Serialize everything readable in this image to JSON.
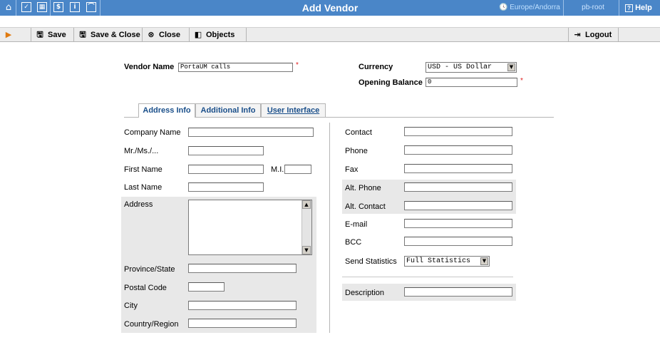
{
  "window": {
    "title": "Add Vendor",
    "timezone": "Europe/Andorra",
    "user": "pb-root",
    "help_label": "Help"
  },
  "topbar_icons": [
    "home-icon",
    "checkbox-icon",
    "calculator-icon",
    "dollar-icon",
    "info-icon",
    "chart-icon"
  ],
  "toolbar": {
    "save_label": "Save",
    "save_close_label": "Save & Close",
    "close_label": "Close",
    "objects_label": "Objects",
    "logout_label": "Logout"
  },
  "vendor": {
    "name_label": "Vendor Name",
    "name_value": "PortaUM calls",
    "currency_label": "Currency",
    "currency_value": "USD - US Dollar",
    "opening_balance_label": "Opening Balance",
    "opening_balance_value": "0"
  },
  "tabs": [
    {
      "label": "Address Info",
      "active": true
    },
    {
      "label": "Additional Info",
      "active": false
    },
    {
      "label": "User Interface",
      "active": false
    }
  ],
  "address": {
    "company_name": "Company Name",
    "salutation": "Mr./Ms./...",
    "first_name": "First Name",
    "mi": "M.I.",
    "last_name": "Last Name",
    "address": "Address",
    "province": "Province/State",
    "postal_code": "Postal Code",
    "city": "City",
    "country": "Country/Region"
  },
  "contact": {
    "contact": "Contact",
    "phone": "Phone",
    "fax": "Fax",
    "alt_phone": "Alt. Phone",
    "alt_contact": "Alt. Contact",
    "email": "E-mail",
    "bcc": "BCC",
    "send_statistics": "Send Statistics",
    "send_statistics_value": "Full Statistics",
    "description": "Description"
  },
  "colors": {
    "topbar": "#4a86c8",
    "required": "#e02020",
    "tab_text": "#1a4f8a"
  }
}
